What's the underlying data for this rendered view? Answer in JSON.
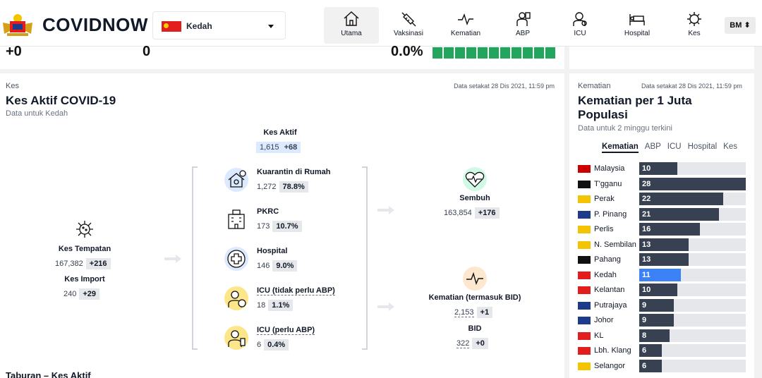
{
  "header": {
    "brand": "COVIDNOW",
    "state_selected": "Kedah",
    "language": "BM ⬍",
    "nav": [
      {
        "label": "Utama",
        "icon": "home-icon",
        "active": true
      },
      {
        "label": "Vaksinasi",
        "icon": "syringe-icon",
        "active": false
      },
      {
        "label": "Kematian",
        "icon": "heartbeat-icon",
        "active": false
      },
      {
        "label": "ABP",
        "icon": "ventilator-icon",
        "active": false
      },
      {
        "label": "ICU",
        "icon": "icu-icon",
        "active": false
      },
      {
        "label": "Hospital",
        "icon": "hospital-bed-icon",
        "active": false
      },
      {
        "label": "Kes",
        "icon": "virus-icon",
        "active": false
      }
    ]
  },
  "top_strip": {
    "v1": "+0",
    "v2": "0",
    "v3": "0.0%"
  },
  "main": {
    "eyebrow": "Kes",
    "title": "Kes Aktif COVID-19",
    "subtitle": "Data untuk Kedah",
    "timestamp": "Data setakat 28 Dis 2021, 11:59 pm",
    "kes_aktif": {
      "label": "Kes Aktif",
      "value": "1,615",
      "delta": "+68"
    },
    "kes_tempatan": {
      "label": "Kes Tempatan",
      "value": "167,382",
      "delta": "+216"
    },
    "kes_import": {
      "label": "Kes Import",
      "value": "240",
      "delta": "+29"
    },
    "middle": [
      {
        "label": "Kuarantin di Rumah",
        "value": "1,272",
        "pct": "78.8%",
        "icon": "home-quarantine-icon"
      },
      {
        "label": "PKRC",
        "value": "173",
        "pct": "10.7%",
        "icon": "building-icon"
      },
      {
        "label": "Hospital",
        "value": "146",
        "pct": "9.0%",
        "icon": "medical-cross-icon"
      },
      {
        "label": "ICU (tidak perlu ABP)",
        "value": "18",
        "pct": "1.1%",
        "icon": "icu-patient-icon"
      },
      {
        "label": "ICU (perlu ABP)",
        "value": "6",
        "pct": "0.4%",
        "icon": "ventilator-patient-icon"
      }
    ],
    "sembuh": {
      "label": "Sembuh",
      "value": "163,854",
      "delta": "+176"
    },
    "kematian": {
      "label": "Kematian (termasuk BID)",
      "value": "2,153",
      "delta": "+1"
    },
    "bid": {
      "label": "BID",
      "value": "322",
      "delta": "+0"
    },
    "next_section": "Taburan – Kes Aktif"
  },
  "side": {
    "eyebrow": "Kematian",
    "timestamp": "Data setakat 28 Dis 2021, 11:59 pm",
    "title_line1": "Kematian per 1 Juta",
    "title_line2": "Populasi",
    "subtitle": "Data untuk 2 minggu terkini",
    "tabs": [
      "Kematian",
      "ABP",
      "ICU",
      "Hospital",
      "Kes"
    ],
    "rows": [
      {
        "name": "Malaysia",
        "value": 10
      },
      {
        "name": "T'gganu",
        "value": 28
      },
      {
        "name": "Perak",
        "value": 22
      },
      {
        "name": "P. Pinang",
        "value": 21
      },
      {
        "name": "Perlis",
        "value": 16
      },
      {
        "name": "N. Sembilan",
        "value": 13
      },
      {
        "name": "Pahang",
        "value": 13
      },
      {
        "name": "Kedah",
        "value": 11,
        "highlight": true
      },
      {
        "name": "Kelantan",
        "value": 10
      },
      {
        "name": "Putrajaya",
        "value": 9
      },
      {
        "name": "Johor",
        "value": 9
      },
      {
        "name": "KL",
        "value": 8
      },
      {
        "name": "Lbh. Klang",
        "value": 6
      },
      {
        "name": "Selangor",
        "value": 6
      }
    ],
    "max": 28
  }
}
